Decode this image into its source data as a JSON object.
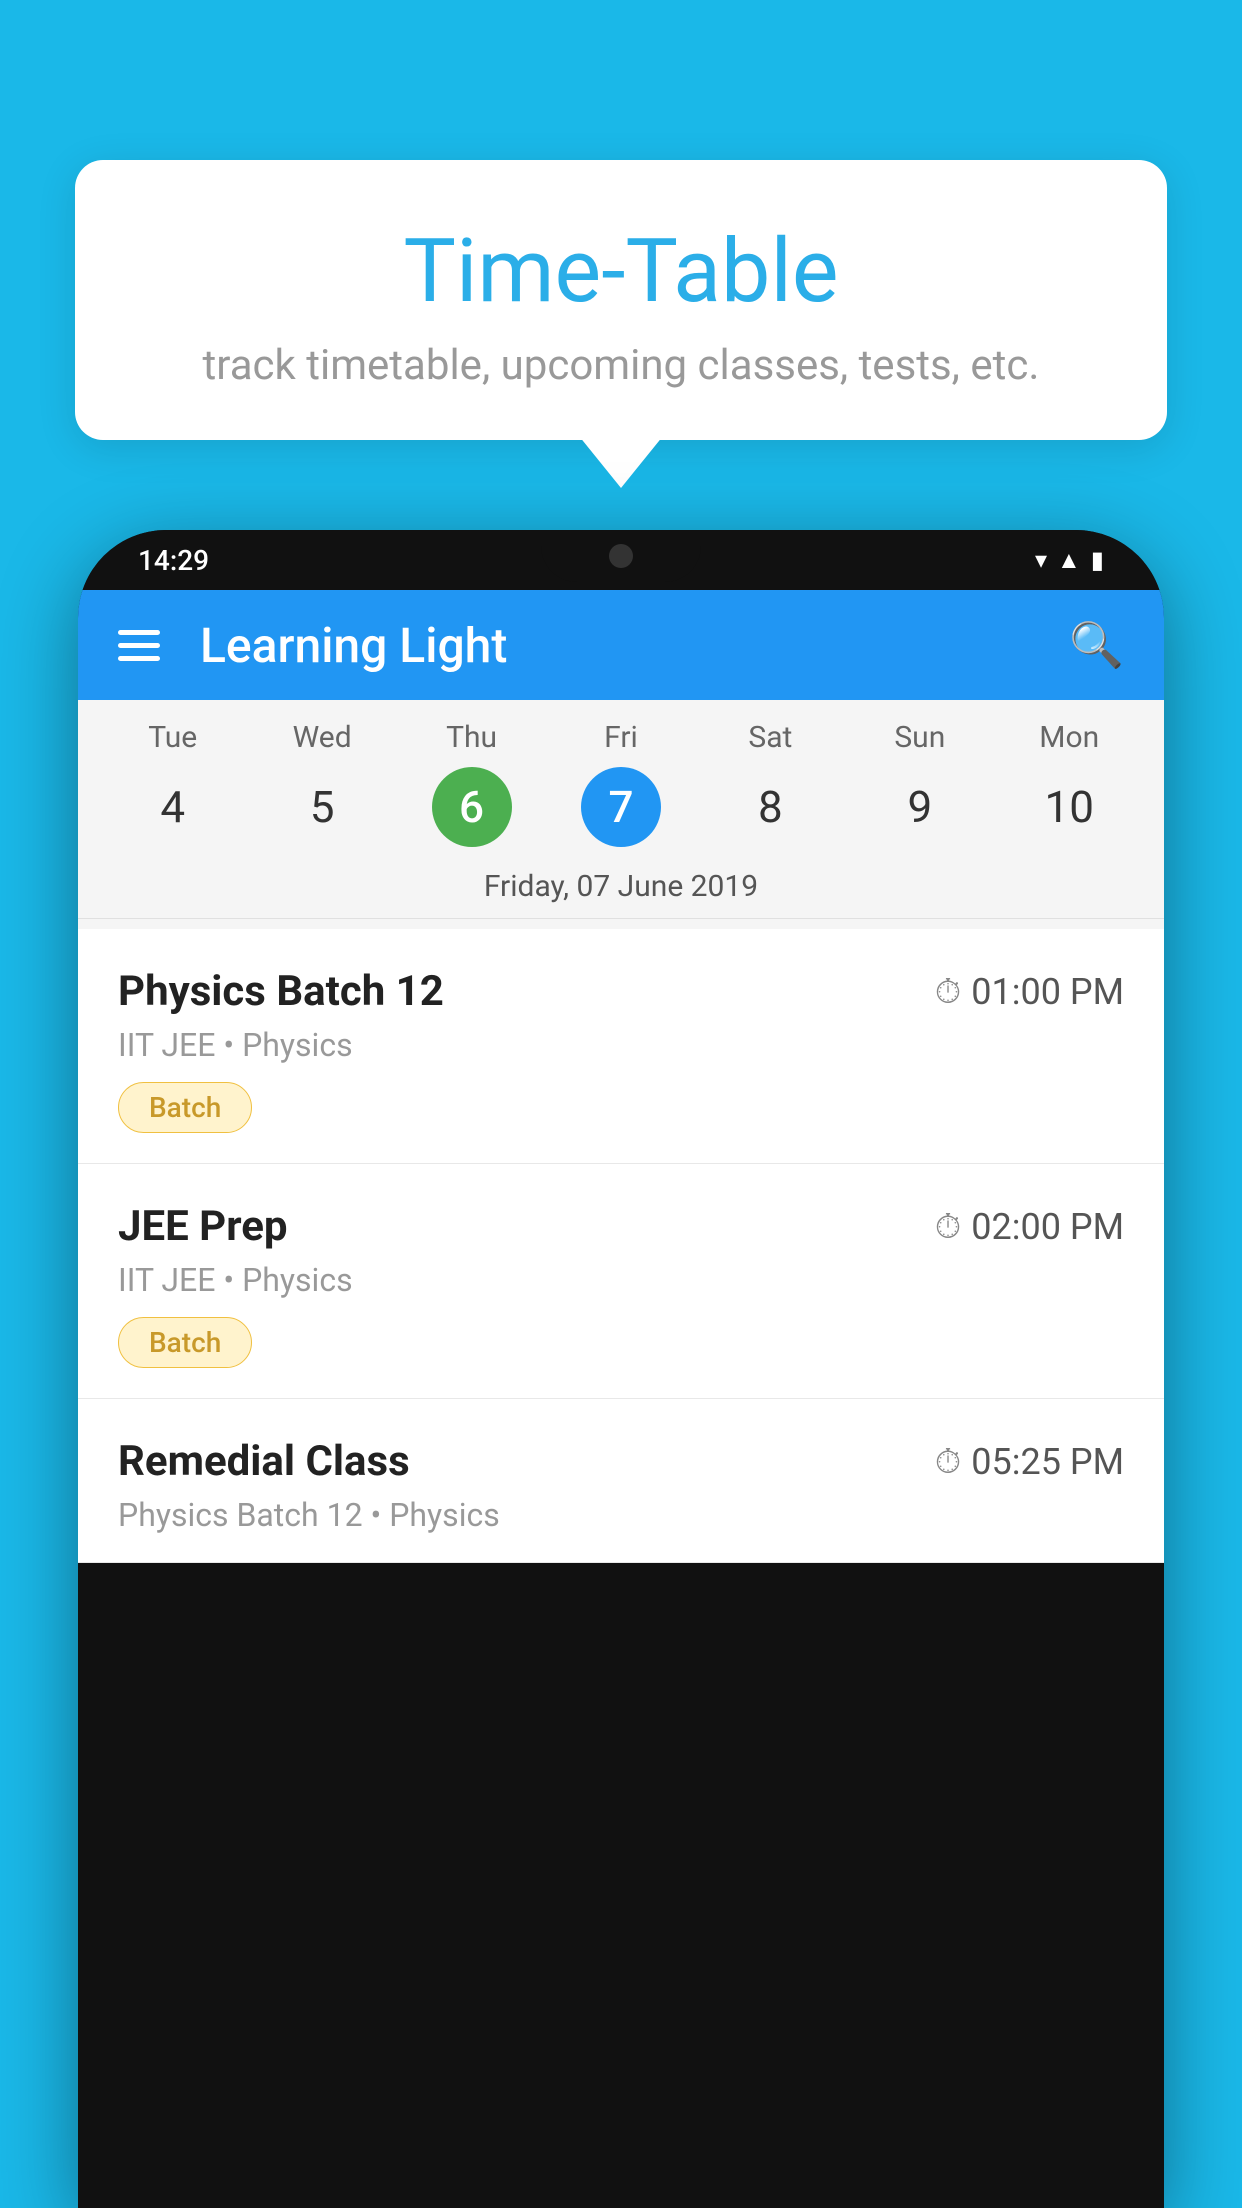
{
  "background": {
    "color": "#1ab8e8"
  },
  "tooltip": {
    "title": "Time-Table",
    "subtitle": "track timetable, upcoming classes, tests, etc."
  },
  "phone": {
    "status_bar": {
      "time": "14:29"
    },
    "app_bar": {
      "title": "Learning Light"
    },
    "calendar": {
      "days": [
        {
          "name": "Tue",
          "num": "4",
          "state": "normal"
        },
        {
          "name": "Wed",
          "num": "5",
          "state": "normal"
        },
        {
          "name": "Thu",
          "num": "6",
          "state": "today"
        },
        {
          "name": "Fri",
          "num": "7",
          "state": "selected"
        },
        {
          "name": "Sat",
          "num": "8",
          "state": "normal"
        },
        {
          "name": "Sun",
          "num": "9",
          "state": "normal"
        },
        {
          "name": "Mon",
          "num": "10",
          "state": "normal"
        }
      ],
      "selected_date_label": "Friday, 07 June 2019"
    },
    "schedule": [
      {
        "title": "Physics Batch 12",
        "time": "01:00 PM",
        "subtitle": "IIT JEE • Physics",
        "badge": "Batch"
      },
      {
        "title": "JEE Prep",
        "time": "02:00 PM",
        "subtitle": "IIT JEE • Physics",
        "badge": "Batch"
      },
      {
        "title": "Remedial Class",
        "time": "05:25 PM",
        "subtitle": "Physics Batch 12 • Physics",
        "badge": ""
      }
    ]
  }
}
